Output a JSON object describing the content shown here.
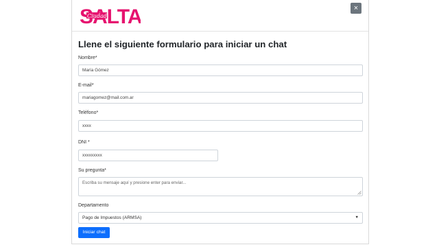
{
  "header": {
    "logo_word": "SALTA",
    "logo_script": "Ciudad",
    "close_glyph": "×",
    "brand_color": "#e6136f"
  },
  "form": {
    "title": "Llene el siguiente formulario para iniciar un chat",
    "nombre": {
      "label": "Nombre*",
      "value": "María Gómez"
    },
    "email": {
      "label": "E-mail*",
      "value": "mariagomez@mail.com.ar"
    },
    "telefono": {
      "label": "Teléfono*",
      "value": "xxxx"
    },
    "dni": {
      "label": "DNI *",
      "value": "xxxxxxxxx"
    },
    "pregunta": {
      "label": "Su pregunta*",
      "placeholder": "Escriba su mensaje aquí y presione enter para enviar..."
    },
    "departamento": {
      "label": "Departamento",
      "selected": "Pago de Impuestos (ARMSA)"
    },
    "submit_label": "Iniciar chat",
    "submit_color": "#0d6efd"
  }
}
